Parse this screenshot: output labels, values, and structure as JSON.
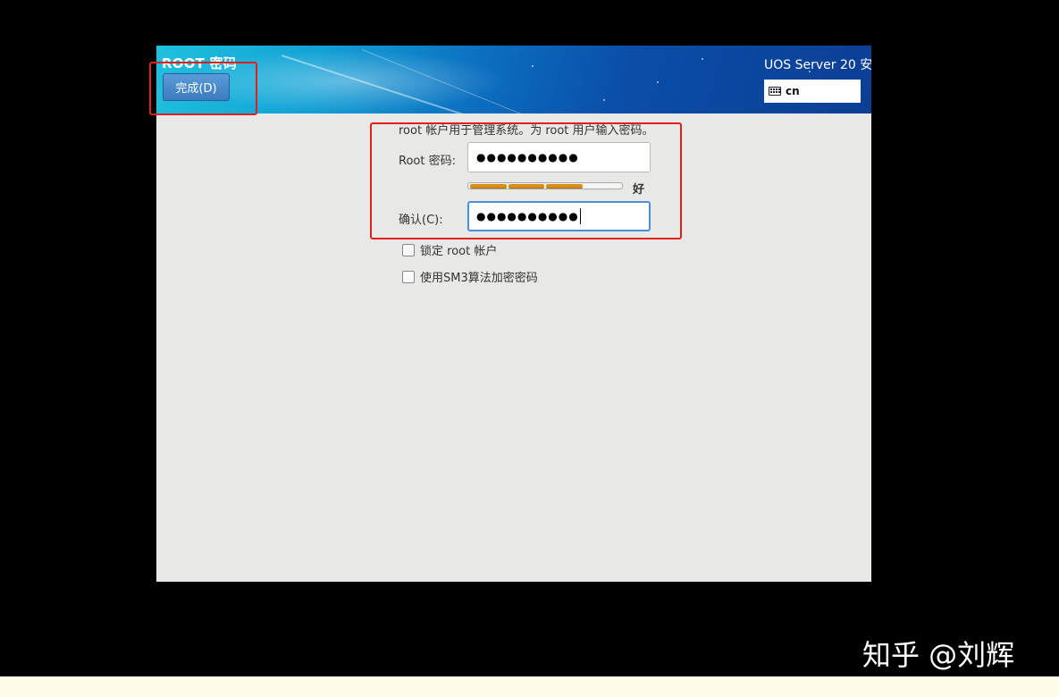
{
  "header": {
    "page_title": "ROOT 密码",
    "done_label": "完成(D)",
    "product_title": "UOS Server 20 安",
    "keyboard_icon": "keyboard-icon",
    "keyboard_layout": "cn"
  },
  "form": {
    "description": "root 帐户用于管理系统。为 root 用户输入密码。",
    "root_password_label": "Root 密码:",
    "root_password_value": "●●●●●●●●●●",
    "strength_text": "好",
    "strength_level": 0.75,
    "confirm_label": "确认(C):",
    "confirm_value": "●●●●●●●●●●",
    "lock_root_label": "锁定 root 帐户",
    "lock_root_checked": false,
    "sm3_label": "使用SM3算法加密密码",
    "sm3_checked": false
  },
  "colors": {
    "annotation_box": "#e02020",
    "strength_bar": "#d88e1a",
    "focus_border": "#4a90d9"
  },
  "watermark": "知乎 @刘辉"
}
